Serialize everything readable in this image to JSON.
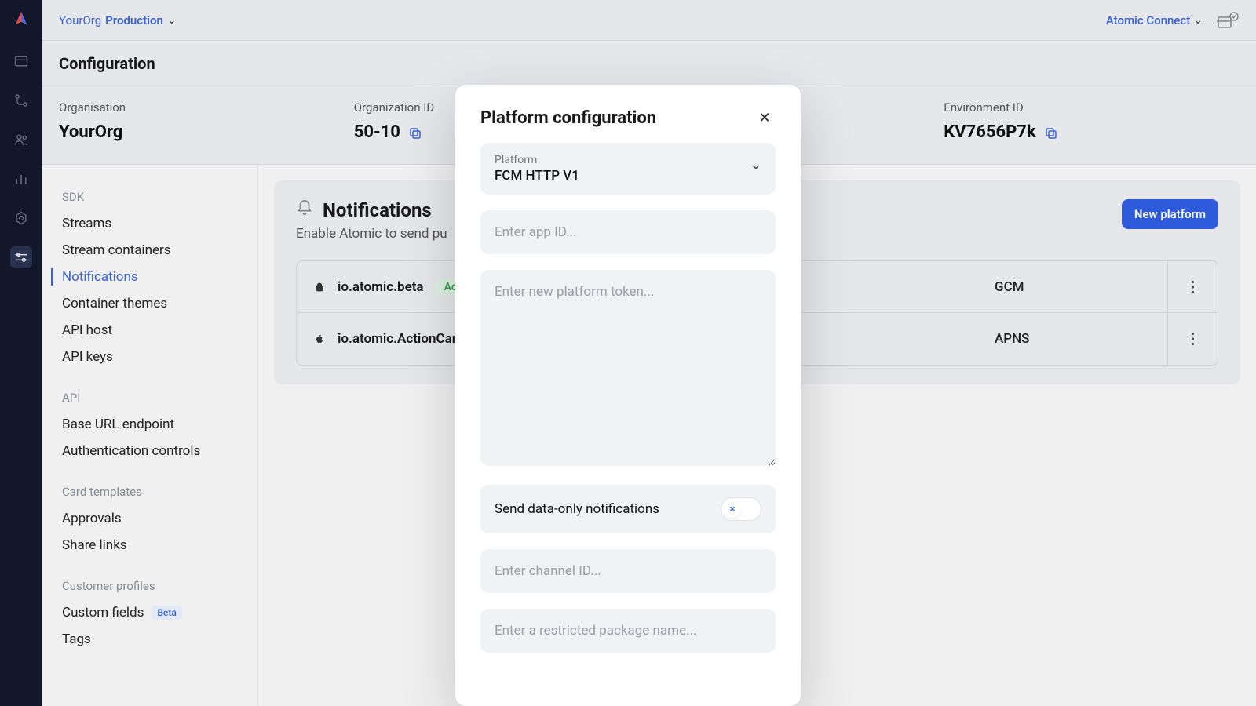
{
  "topbar": {
    "org": "YourOrg",
    "env": "Production",
    "connect": "Atomic Connect"
  },
  "page": {
    "title": "Configuration"
  },
  "info": {
    "org_label": "Organisation",
    "org_value": "YourOrg",
    "orgid_label": "Organization ID",
    "orgid_value": "50-10",
    "envid_label": "Environment ID",
    "envid_value": "KV7656P7k"
  },
  "sidenav": {
    "groups": [
      {
        "label": "SDK",
        "items": [
          {
            "label": "Streams"
          },
          {
            "label": "Stream containers"
          },
          {
            "label": "Notifications",
            "active": true
          },
          {
            "label": "Container themes"
          },
          {
            "label": "API host"
          },
          {
            "label": "API keys"
          }
        ]
      },
      {
        "label": "API",
        "items": [
          {
            "label": "Base URL endpoint"
          },
          {
            "label": "Authentication controls"
          }
        ]
      },
      {
        "label": "Card templates",
        "items": [
          {
            "label": "Approvals"
          },
          {
            "label": "Share links"
          }
        ]
      },
      {
        "label": "Customer profiles",
        "items": [
          {
            "label": "Custom fields",
            "badge": "Beta"
          },
          {
            "label": "Tags"
          }
        ]
      }
    ]
  },
  "panel": {
    "title": "Notifications",
    "subtitle": "Enable Atomic to send pu",
    "button": "New platform",
    "rows": [
      {
        "icon": "android",
        "id": "io.atomic.beta",
        "status": "Activ",
        "platform": "GCM"
      },
      {
        "icon": "apple",
        "id": "io.atomic.ActionCard",
        "status": "",
        "platform": "APNS"
      }
    ]
  },
  "modal": {
    "title": "Platform configuration",
    "platform_label": "Platform",
    "platform_value": "FCM HTTP V1",
    "appid_placeholder": "Enter app ID...",
    "token_placeholder": "Enter new platform token...",
    "dataonly_label": "Send data-only notifications",
    "toggle_icon": "×",
    "channel_placeholder": "Enter channel ID...",
    "package_placeholder": "Enter a restricted package name..."
  }
}
